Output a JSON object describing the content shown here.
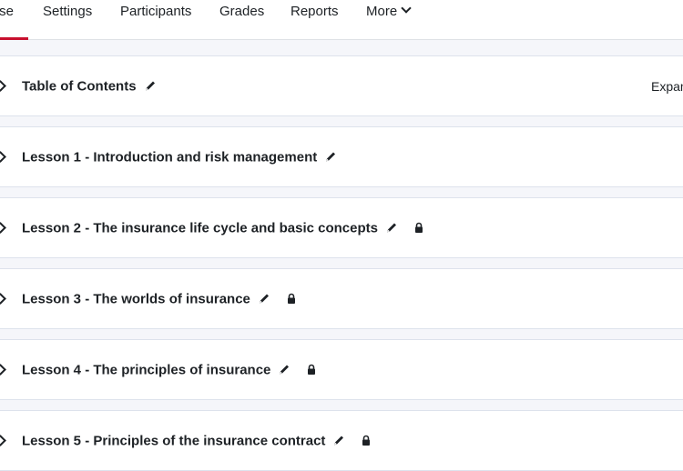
{
  "nav": {
    "tabs": {
      "course": "Course",
      "course_visible": "se",
      "settings": "Settings",
      "participants": "Participants",
      "grades": "Grades",
      "reports": "Reports",
      "more": "More"
    }
  },
  "sections": [
    {
      "title": "Table of Contents",
      "locked": false
    },
    {
      "title": "Lesson 1 - Introduction and risk management",
      "locked": false
    },
    {
      "title": "Lesson 2 - The insurance life cycle and basic concepts",
      "locked": true
    },
    {
      "title": "Lesson 3 - The worlds of insurance",
      "locked": true
    },
    {
      "title": "Lesson 4 - The principles of insurance",
      "locked": true
    },
    {
      "title": "Lesson 5 - Principles of the insurance contract",
      "locked": true
    }
  ],
  "toolbar": {
    "expand_label": "Expand all"
  },
  "icons": {
    "pencil": "pencil-icon",
    "lock": "lock-icon",
    "chevron": "chevron-right-icon",
    "more": "chevron-down-icon"
  },
  "colors": {
    "active_tab": "#c8102e",
    "background": "#f5f6fa",
    "text": "#1d2125"
  }
}
